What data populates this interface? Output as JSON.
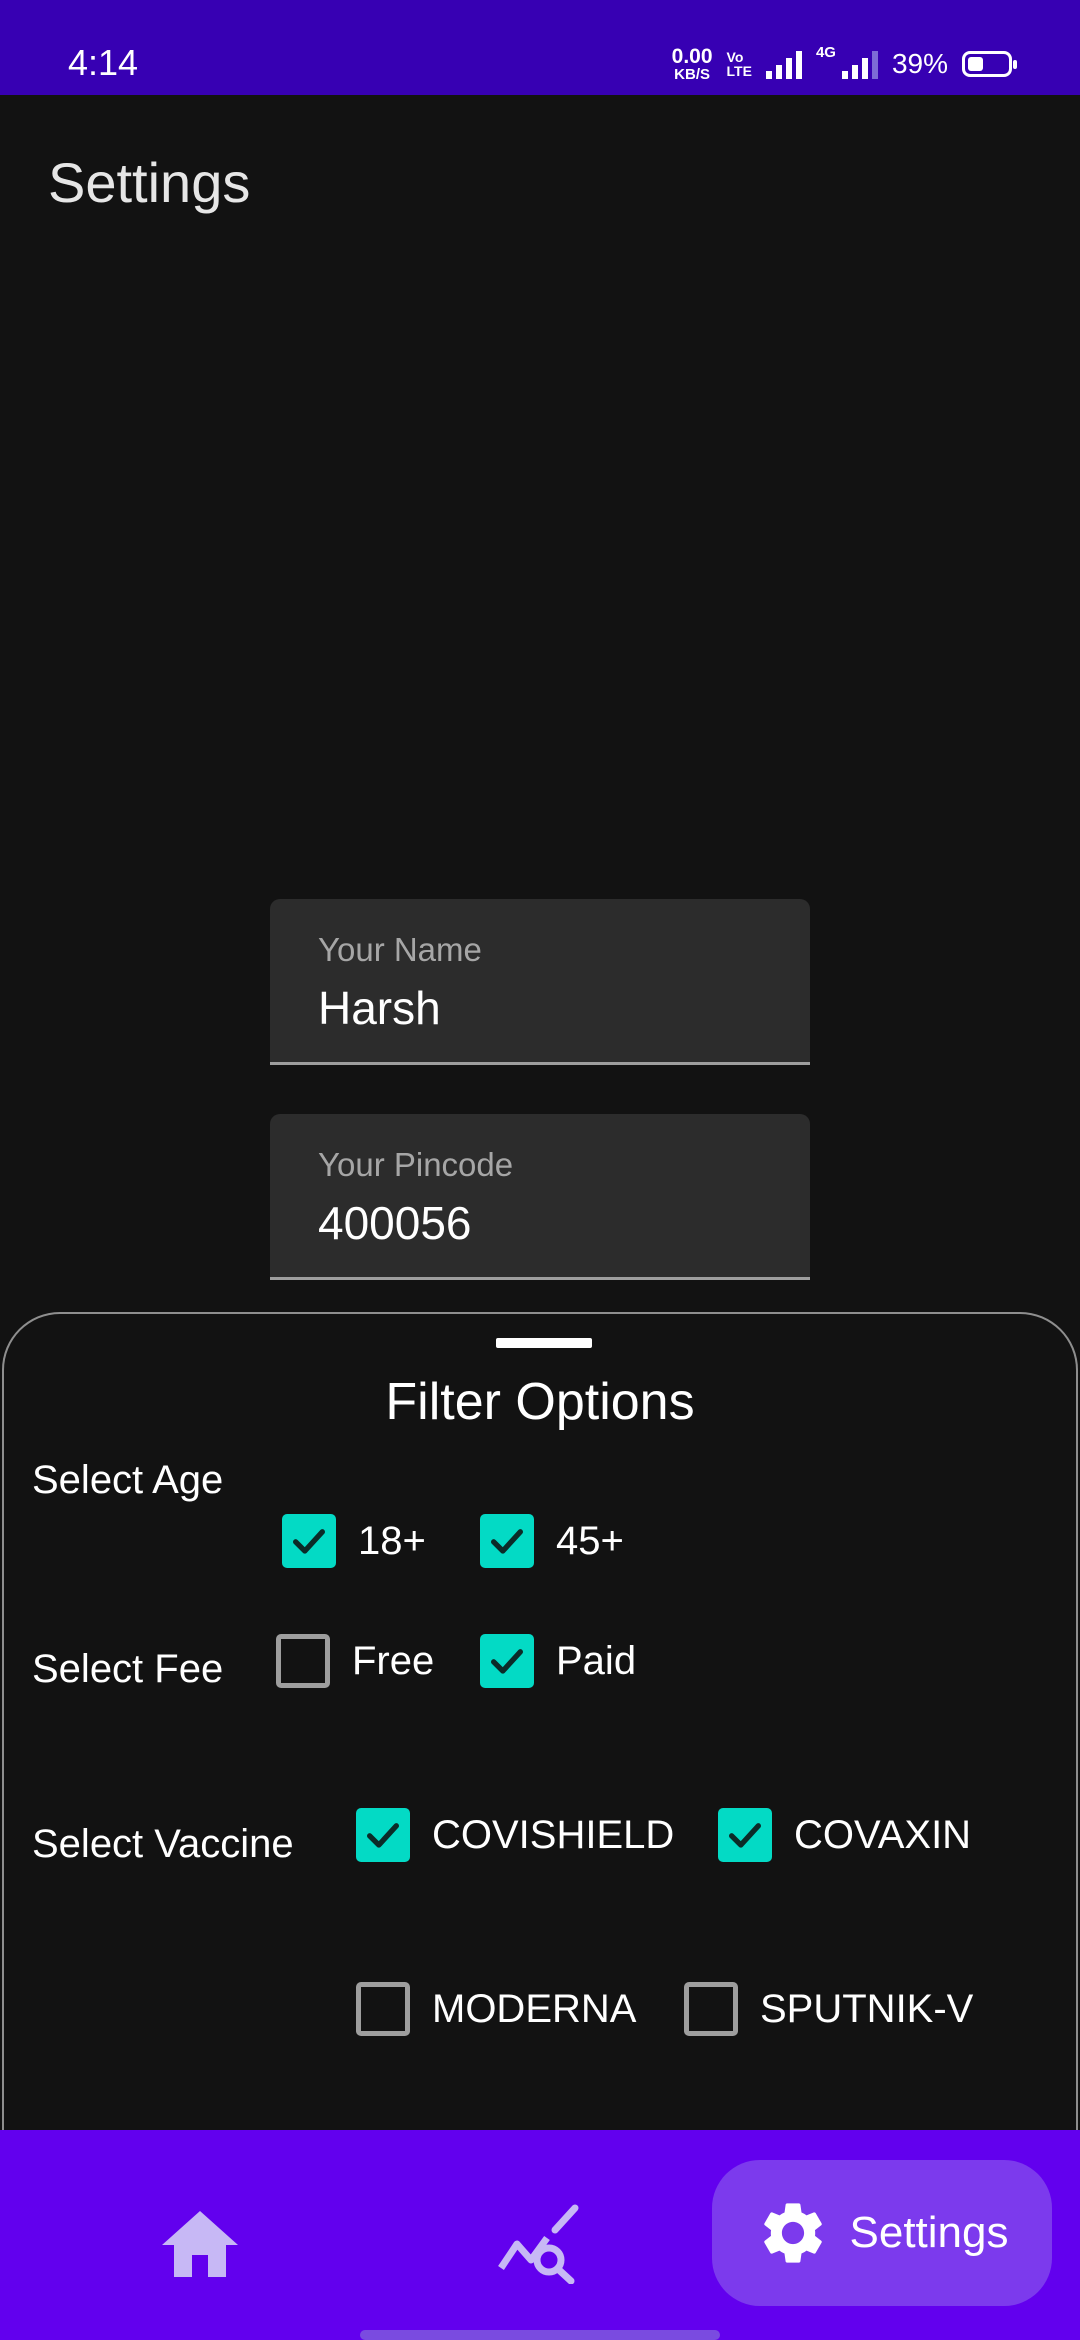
{
  "status_bar": {
    "time": "4:14",
    "net_speed": "0.00",
    "net_speed_unit": "KB/S",
    "volte_top": "Vo",
    "volte_bottom": "LTE",
    "network_type": "4G",
    "battery_percent": "39%",
    "battery_level": 0.39
  },
  "page": {
    "title": "Settings"
  },
  "fields": {
    "name": {
      "label": "Your Name",
      "value": "Harsh"
    },
    "pincode": {
      "label": "Your Pincode",
      "value": "400056"
    }
  },
  "filter_sheet": {
    "title": "Filter Options",
    "age": {
      "label": "Select Age",
      "options": [
        {
          "label": "18+",
          "checked": true
        },
        {
          "label": "45+",
          "checked": true
        }
      ]
    },
    "fee": {
      "label": "Select Fee",
      "options": [
        {
          "label": "Free",
          "checked": false
        },
        {
          "label": "Paid",
          "checked": true
        }
      ]
    },
    "vaccine": {
      "label": "Select Vaccine",
      "options": [
        {
          "label": "COVISHIELD",
          "checked": true
        },
        {
          "label": "COVAXIN",
          "checked": true
        },
        {
          "label": "MODERNA",
          "checked": false
        },
        {
          "label": "SPUTNIK-V",
          "checked": false
        }
      ]
    }
  },
  "bottom_nav": {
    "items": [
      {
        "icon": "home-icon",
        "label": "",
        "selected": false
      },
      {
        "icon": "stats-search-icon",
        "label": "",
        "selected": false
      },
      {
        "icon": "gear-icon",
        "label": "Settings",
        "selected": true
      }
    ]
  },
  "colors": {
    "status_bar": "#3700b3",
    "nav_bar": "#6200ee",
    "nav_selected": "#7c3aed",
    "checkbox_checked": "#03dac5",
    "background": "#121212"
  }
}
